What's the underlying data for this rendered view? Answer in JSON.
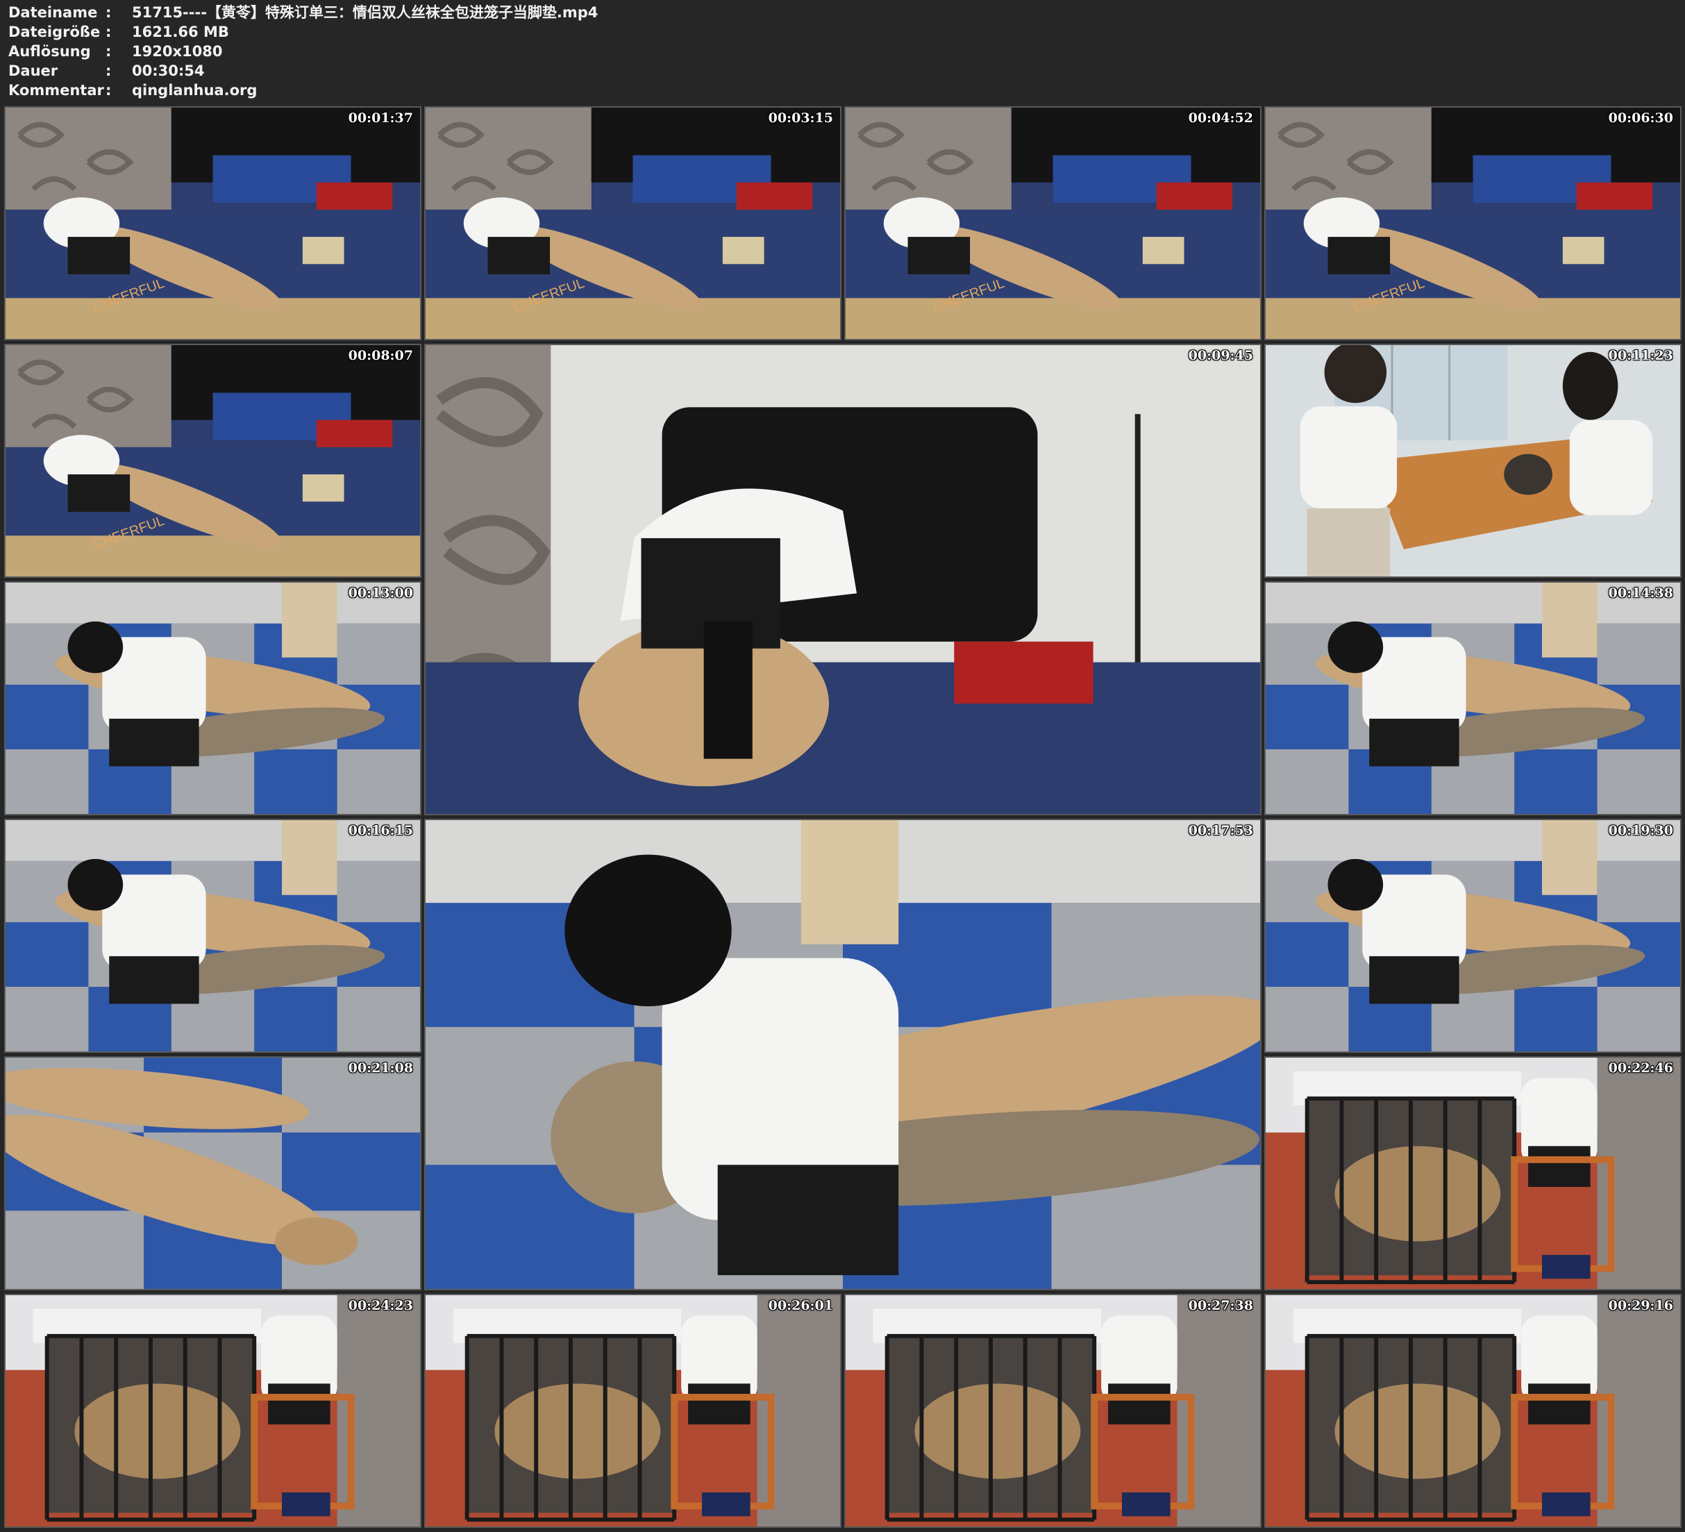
{
  "info": {
    "filename": {
      "label": "Dateiname",
      "sep": ":",
      "value": "51715----【黄苓】特殊订单三：情侣双人丝袜全包进笼子当脚垫.mp4"
    },
    "filesize": {
      "label": "Dateigröße",
      "sep": ":",
      "value": "1621.66 MB"
    },
    "resolution": {
      "label": "Auflösung",
      "sep": ":",
      "value": "1920x1080"
    },
    "duration": {
      "label": "Dauer",
      "sep": ":",
      "value": "00:30:54"
    },
    "comment": {
      "label": "Kommentar",
      "sep": ":",
      "value": "qinglanhua.org"
    }
  },
  "thumbnails": [
    {
      "timestamp": "00:01:37",
      "scene": "bedroom-floor"
    },
    {
      "timestamp": "00:03:15",
      "scene": "bedroom-floor"
    },
    {
      "timestamp": "00:04:52",
      "scene": "bedroom-floor"
    },
    {
      "timestamp": "00:06:30",
      "scene": "bedroom-floor"
    },
    {
      "timestamp": "00:08:07",
      "scene": "bedroom-floor"
    },
    {
      "timestamp": "00:09:45",
      "scene": "bedroom-closeup"
    },
    {
      "timestamp": "00:11:23",
      "scene": "dining-table"
    },
    {
      "timestamp": "00:13:00",
      "scene": "mat-floor"
    },
    {
      "timestamp": "00:14:38",
      "scene": "mat-floor"
    },
    {
      "timestamp": "00:16:15",
      "scene": "mat-floor"
    },
    {
      "timestamp": "00:17:53",
      "scene": "mat-closeup"
    },
    {
      "timestamp": "00:19:30",
      "scene": "mat-floor"
    },
    {
      "timestamp": "00:21:08",
      "scene": "mat-legs"
    },
    {
      "timestamp": "00:22:46",
      "scene": "cage"
    },
    {
      "timestamp": "00:24:23",
      "scene": "cage"
    },
    {
      "timestamp": "00:26:01",
      "scene": "cage"
    },
    {
      "timestamp": "00:27:38",
      "scene": "cage"
    },
    {
      "timestamp": "00:29:16",
      "scene": "cage"
    }
  ],
  "colors": {
    "background": "#262626",
    "text": "#f2f2f2",
    "border": "#5a5a5a",
    "quilt": "#2c3d6e",
    "wall": "#dcdcd8",
    "skin_tan": "#c9a57a",
    "shirt": "#f4f4f2",
    "shorts": "#1a1a1a",
    "mat_blue": "#2f57a8",
    "mat_gray": "#a4a7ab",
    "wood_floor": "#b04a32"
  }
}
